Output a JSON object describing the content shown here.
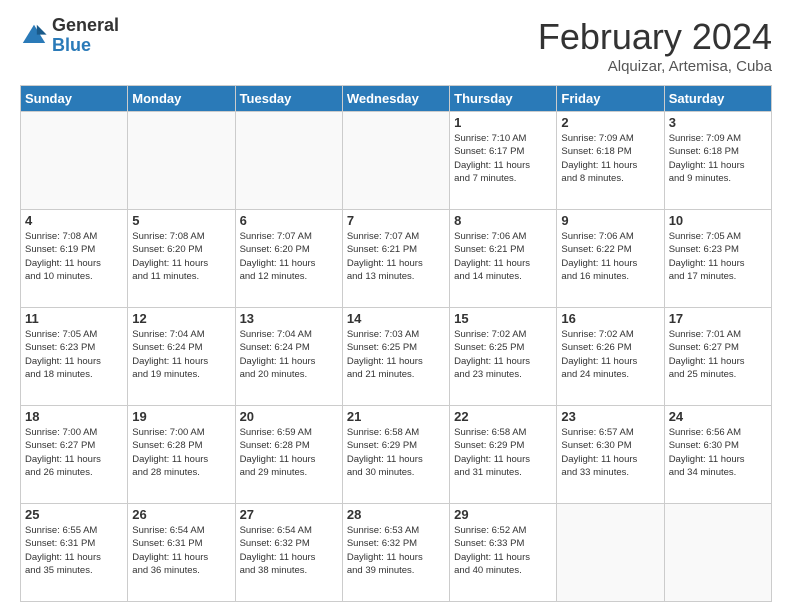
{
  "header": {
    "logo_general": "General",
    "logo_blue": "Blue",
    "month_title": "February 2024",
    "subtitle": "Alquizar, Artemisa, Cuba"
  },
  "days_of_week": [
    "Sunday",
    "Monday",
    "Tuesday",
    "Wednesday",
    "Thursday",
    "Friday",
    "Saturday"
  ],
  "weeks": [
    [
      {
        "day": "",
        "info": ""
      },
      {
        "day": "",
        "info": ""
      },
      {
        "day": "",
        "info": ""
      },
      {
        "day": "",
        "info": ""
      },
      {
        "day": "1",
        "info": "Sunrise: 7:10 AM\nSunset: 6:17 PM\nDaylight: 11 hours\nand 7 minutes."
      },
      {
        "day": "2",
        "info": "Sunrise: 7:09 AM\nSunset: 6:18 PM\nDaylight: 11 hours\nand 8 minutes."
      },
      {
        "day": "3",
        "info": "Sunrise: 7:09 AM\nSunset: 6:18 PM\nDaylight: 11 hours\nand 9 minutes."
      }
    ],
    [
      {
        "day": "4",
        "info": "Sunrise: 7:08 AM\nSunset: 6:19 PM\nDaylight: 11 hours\nand 10 minutes."
      },
      {
        "day": "5",
        "info": "Sunrise: 7:08 AM\nSunset: 6:20 PM\nDaylight: 11 hours\nand 11 minutes."
      },
      {
        "day": "6",
        "info": "Sunrise: 7:07 AM\nSunset: 6:20 PM\nDaylight: 11 hours\nand 12 minutes."
      },
      {
        "day": "7",
        "info": "Sunrise: 7:07 AM\nSunset: 6:21 PM\nDaylight: 11 hours\nand 13 minutes."
      },
      {
        "day": "8",
        "info": "Sunrise: 7:06 AM\nSunset: 6:21 PM\nDaylight: 11 hours\nand 14 minutes."
      },
      {
        "day": "9",
        "info": "Sunrise: 7:06 AM\nSunset: 6:22 PM\nDaylight: 11 hours\nand 16 minutes."
      },
      {
        "day": "10",
        "info": "Sunrise: 7:05 AM\nSunset: 6:23 PM\nDaylight: 11 hours\nand 17 minutes."
      }
    ],
    [
      {
        "day": "11",
        "info": "Sunrise: 7:05 AM\nSunset: 6:23 PM\nDaylight: 11 hours\nand 18 minutes."
      },
      {
        "day": "12",
        "info": "Sunrise: 7:04 AM\nSunset: 6:24 PM\nDaylight: 11 hours\nand 19 minutes."
      },
      {
        "day": "13",
        "info": "Sunrise: 7:04 AM\nSunset: 6:24 PM\nDaylight: 11 hours\nand 20 minutes."
      },
      {
        "day": "14",
        "info": "Sunrise: 7:03 AM\nSunset: 6:25 PM\nDaylight: 11 hours\nand 21 minutes."
      },
      {
        "day": "15",
        "info": "Sunrise: 7:02 AM\nSunset: 6:25 PM\nDaylight: 11 hours\nand 23 minutes."
      },
      {
        "day": "16",
        "info": "Sunrise: 7:02 AM\nSunset: 6:26 PM\nDaylight: 11 hours\nand 24 minutes."
      },
      {
        "day": "17",
        "info": "Sunrise: 7:01 AM\nSunset: 6:27 PM\nDaylight: 11 hours\nand 25 minutes."
      }
    ],
    [
      {
        "day": "18",
        "info": "Sunrise: 7:00 AM\nSunset: 6:27 PM\nDaylight: 11 hours\nand 26 minutes."
      },
      {
        "day": "19",
        "info": "Sunrise: 7:00 AM\nSunset: 6:28 PM\nDaylight: 11 hours\nand 28 minutes."
      },
      {
        "day": "20",
        "info": "Sunrise: 6:59 AM\nSunset: 6:28 PM\nDaylight: 11 hours\nand 29 minutes."
      },
      {
        "day": "21",
        "info": "Sunrise: 6:58 AM\nSunset: 6:29 PM\nDaylight: 11 hours\nand 30 minutes."
      },
      {
        "day": "22",
        "info": "Sunrise: 6:58 AM\nSunset: 6:29 PM\nDaylight: 11 hours\nand 31 minutes."
      },
      {
        "day": "23",
        "info": "Sunrise: 6:57 AM\nSunset: 6:30 PM\nDaylight: 11 hours\nand 33 minutes."
      },
      {
        "day": "24",
        "info": "Sunrise: 6:56 AM\nSunset: 6:30 PM\nDaylight: 11 hours\nand 34 minutes."
      }
    ],
    [
      {
        "day": "25",
        "info": "Sunrise: 6:55 AM\nSunset: 6:31 PM\nDaylight: 11 hours\nand 35 minutes."
      },
      {
        "day": "26",
        "info": "Sunrise: 6:54 AM\nSunset: 6:31 PM\nDaylight: 11 hours\nand 36 minutes."
      },
      {
        "day": "27",
        "info": "Sunrise: 6:54 AM\nSunset: 6:32 PM\nDaylight: 11 hours\nand 38 minutes."
      },
      {
        "day": "28",
        "info": "Sunrise: 6:53 AM\nSunset: 6:32 PM\nDaylight: 11 hours\nand 39 minutes."
      },
      {
        "day": "29",
        "info": "Sunrise: 6:52 AM\nSunset: 6:33 PM\nDaylight: 11 hours\nand 40 minutes."
      },
      {
        "day": "",
        "info": ""
      },
      {
        "day": "",
        "info": ""
      }
    ]
  ]
}
